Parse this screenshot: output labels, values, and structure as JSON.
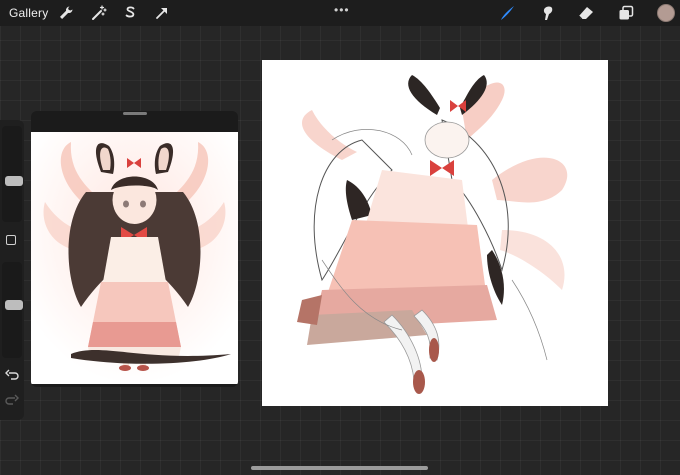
{
  "topbar": {
    "gallery_label": "Gallery",
    "left_tools": [
      {
        "name": "wrench-icon"
      },
      {
        "name": "magic-wand-icon"
      },
      {
        "name": "selection-s-icon"
      },
      {
        "name": "transform-arrow-icon"
      }
    ],
    "more_label": "•••",
    "right_tools": [
      {
        "name": "brush-icon",
        "active": true
      },
      {
        "name": "smudge-icon"
      },
      {
        "name": "eraser-icon"
      },
      {
        "name": "layers-icon"
      }
    ],
    "color_swatch": "#b39b93"
  },
  "sidebar": {
    "brush_size_level": 0.5,
    "opacity_level": 0.5,
    "modifier_icon": "square-modify-icon",
    "undo_icon": "undo-icon",
    "redo_icon": "redo-icon"
  },
  "colors": {
    "accent_blue": "#2f8cff",
    "background": "#262626",
    "toolbar": "#1d1d1d"
  }
}
